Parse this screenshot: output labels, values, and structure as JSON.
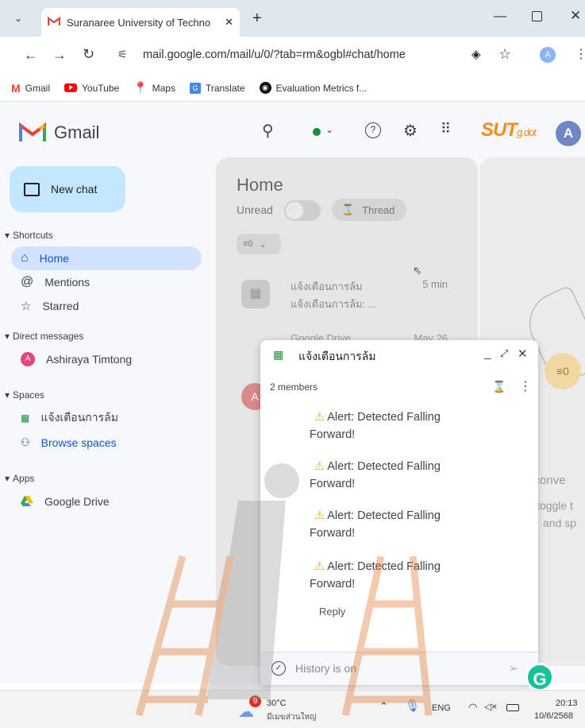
{
  "browser": {
    "tab_title": "Suranaree University of Techno",
    "url": "mail.google.com/mail/u/0/?tab=rm&ogbl#chat/home",
    "profile_initial": "A",
    "bookmarks": [
      "Gmail",
      "YouTube",
      "Maps",
      "Translate",
      "Evaluation Metrics f..."
    ]
  },
  "gmail": {
    "app_name": "Gmail",
    "account_initial": "A",
    "org_logo_text": "SUT",
    "org_logo_sub": "g.dot",
    "new_chat": "New chat",
    "shortcuts_label": "Shortcuts",
    "shortcuts": [
      "Home",
      "Mentions",
      "Starred"
    ],
    "dm_label": "Direct messages",
    "dms": [
      {
        "name": "Ashiraya Timtong",
        "initial": "A"
      }
    ],
    "spaces_label": "Spaces",
    "spaces": [
      "แจ้งเตือนการล้ม",
      "Browse spaces"
    ],
    "apps_label": "Apps",
    "apps": [
      "Google Drive"
    ]
  },
  "home": {
    "title": "Home",
    "unread_label": "Unread",
    "thread_label": "Thread",
    "filter_icon_text": "≡0",
    "list": [
      {
        "name": "แจ้งเตือนการล้ม",
        "time": "5 min",
        "preview": "แจ้งเตือนการล้ม: ..."
      },
      {
        "name": "Google Drive",
        "time": "May 26",
        "preview": ""
      }
    ],
    "right_text_1": "o conve",
    "right_text_2": "toggle t",
    "right_text_3": "and sp"
  },
  "chat": {
    "space_name": "แจ้งเตือนการล้ม",
    "members": "2 members",
    "messages": [
      {
        "line1": "Alert: Detected Falling",
        "line2": "Forward!"
      },
      {
        "line1": "Alert: Detected Falling",
        "line2": "Forward!"
      },
      {
        "line1": "Alert: Detected Falling",
        "line2": "Forward!"
      },
      {
        "line1": "Alert: Detected Falling",
        "line2": "Forward!"
      }
    ],
    "reply": "Reply",
    "history": "History is on"
  },
  "taskbar": {
    "weather_badge": "9",
    "temp": "30°C",
    "weather_desc": "มีเมฆส่วนใหญ่",
    "lang": "ENG",
    "time": "20:13",
    "date": "10/6/2568"
  },
  "colors": {
    "accent_blue": "#0b57d0",
    "home_highlight": "#d3e3fd",
    "new_chat_bg": "#c2e7ff",
    "gmail_red": "#ea4335",
    "green_status": "#1e8e3e"
  }
}
